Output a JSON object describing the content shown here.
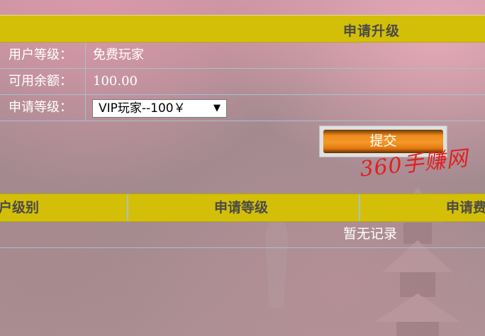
{
  "banner": {
    "title": "申请升级"
  },
  "form": {
    "rows": [
      {
        "label": "用户等级：",
        "value": "免费玩家"
      },
      {
        "label": "可用余额：",
        "value": "100.00"
      },
      {
        "label": "申请等级：",
        "select_value": "VIP玩家--100￥"
      }
    ],
    "submit_label": "提交"
  },
  "watermark": "360手赚网",
  "list": {
    "columns": [
      "户级别",
      "申请等级",
      "申请费"
    ],
    "empty_text": "暂无记录"
  },
  "colors": {
    "header_bg": "#d3bf07",
    "button_orange": "#f08a1b",
    "watermark_red": "#e02020"
  }
}
